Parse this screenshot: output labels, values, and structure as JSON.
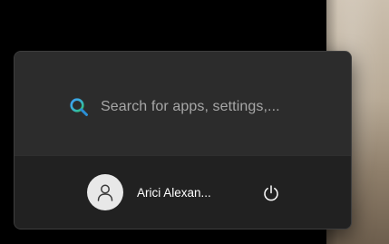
{
  "search": {
    "placeholder": "Search for apps, settings,...",
    "icon": "search-icon"
  },
  "user": {
    "name": "Arici Alexan...",
    "avatar_icon": "person-icon"
  },
  "power": {
    "icon": "power-icon"
  },
  "colors": {
    "menu_background": "#2a2a2a",
    "footer_background": "#212121",
    "placeholder_text": "#a7a7a7",
    "search_icon_blue": "#3c9ff5",
    "search_icon_green": "#2fc56a"
  }
}
